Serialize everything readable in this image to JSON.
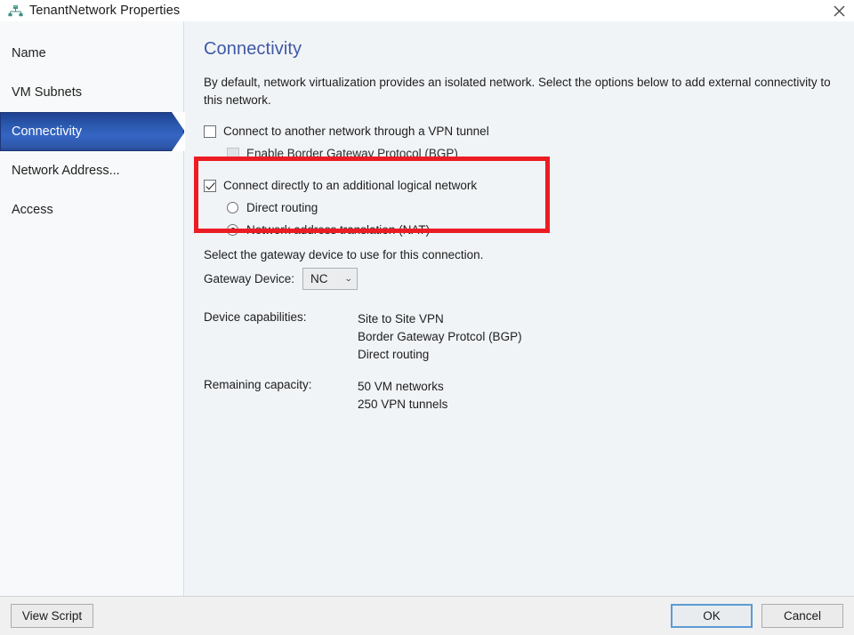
{
  "window": {
    "title": "TenantNetwork Properties",
    "icon": "network-properties-icon",
    "close_label": "✕"
  },
  "sidebar": {
    "items": [
      {
        "label": "Name",
        "name": "sidebar-item-name",
        "selected": false
      },
      {
        "label": "VM Subnets",
        "name": "sidebar-item-vm-subnets",
        "selected": false
      },
      {
        "label": "Connectivity",
        "name": "sidebar-item-connectivity",
        "selected": true
      },
      {
        "label": "Network Address...",
        "name": "sidebar-item-network-address",
        "selected": false
      },
      {
        "label": "Access",
        "name": "sidebar-item-access",
        "selected": false
      }
    ],
    "selected_color": "#2a58ae"
  },
  "content": {
    "page_title": "Connectivity",
    "intro": "By default, network virtualization provides an isolated network. Select the options below to add external connectivity to this network.",
    "options": {
      "vpn_tunnel": {
        "label": "Connect to another network through a VPN tunnel",
        "checked": false
      },
      "bgp": {
        "label": "Enable Border Gateway Protocol (BGP)",
        "checked": false,
        "disabled": true
      },
      "logical_network": {
        "label": "Connect directly to an additional logical network",
        "checked": true
      },
      "direct_routing": {
        "label": "Direct routing",
        "selected": false
      },
      "nat": {
        "label": "Network address translation (NAT)",
        "selected": true
      }
    },
    "gateway": {
      "instruction": "Select the gateway device to use for this connection.",
      "label": "Gateway Device:",
      "value": "NC",
      "caret": "⌄"
    },
    "details": {
      "capabilities_label": "Device capabilities:",
      "capabilities": [
        "Site to Site VPN",
        "Border Gateway Protcol (BGP)",
        "Direct routing"
      ],
      "capacity_label": "Remaining capacity:",
      "capacity": [
        "50 VM networks",
        "250 VPN tunnels"
      ]
    },
    "annotation": {
      "name": "red-highlight-box",
      "color": "#ec1c24"
    }
  },
  "footer": {
    "view_script": "View Script",
    "ok": "OK",
    "cancel": "Cancel"
  }
}
